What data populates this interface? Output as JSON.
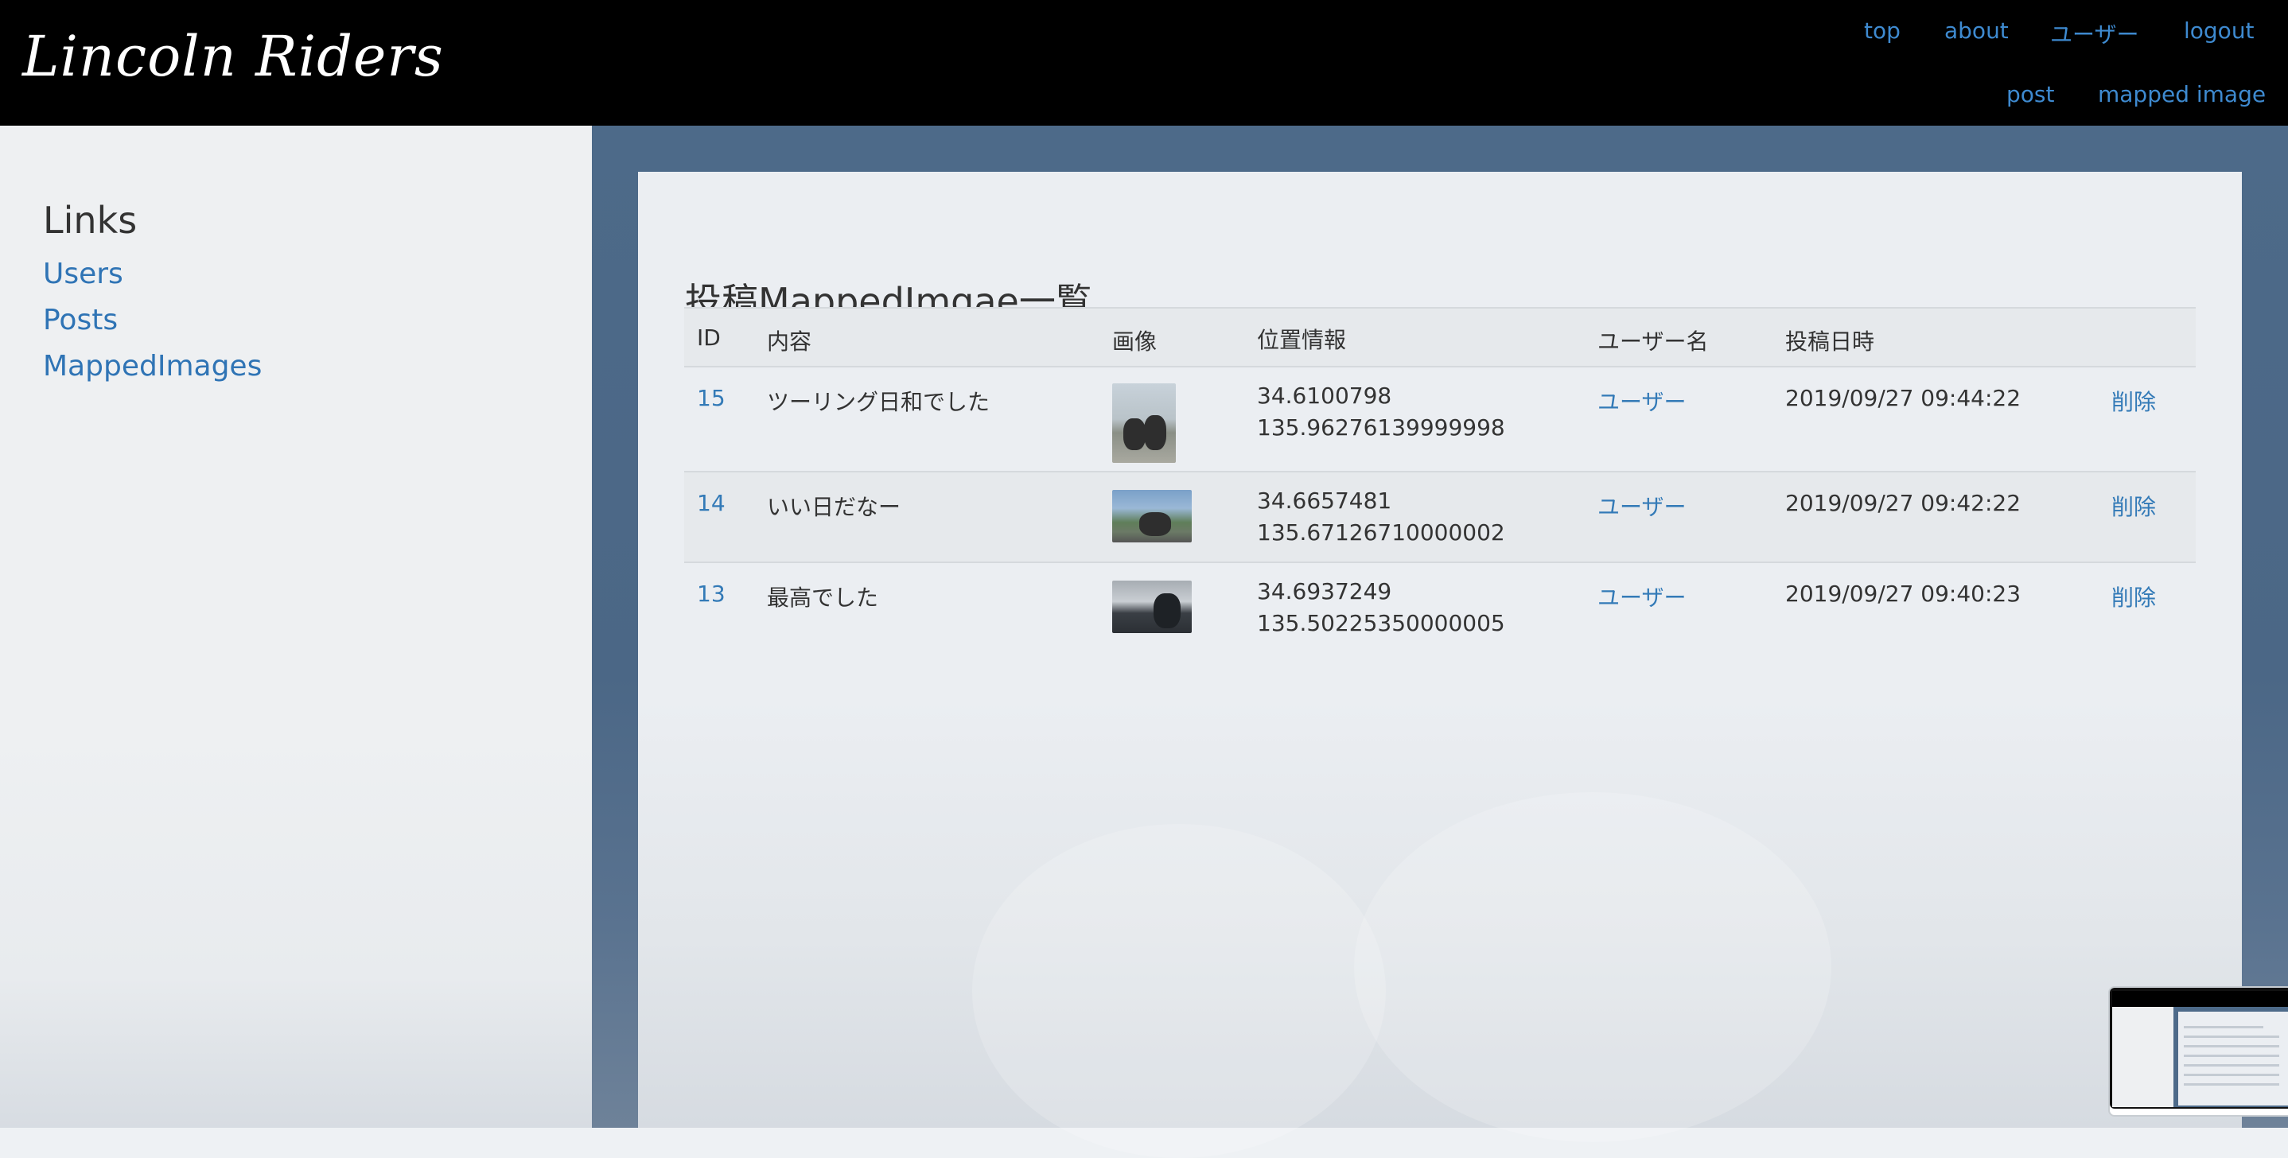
{
  "header": {
    "brand": "Lincoln Riders",
    "nav": [
      {
        "label": "top"
      },
      {
        "label": "about"
      },
      {
        "label": "ユーザー"
      },
      {
        "label": "logout"
      },
      {
        "label": "post"
      },
      {
        "label": "mapped image"
      }
    ]
  },
  "sidebar": {
    "title": "Links",
    "links": [
      {
        "label": "Users"
      },
      {
        "label": "Posts"
      },
      {
        "label": "MappedImages"
      }
    ]
  },
  "main": {
    "title": "投稿MappedImgae一覧",
    "columns": [
      "ID",
      "内容",
      "画像",
      "位置情報",
      "ユーザー名",
      "投稿日時"
    ],
    "rows": [
      {
        "id": "15",
        "content": "ツーリング日和でした",
        "lat": "34.6100798",
        "lng": "135.96276139999998",
        "user": "ユーザー",
        "date": "2019/09/27 09:44:22",
        "delete": "削除"
      },
      {
        "id": "14",
        "content": "いい日だなー",
        "lat": "34.6657481",
        "lng": "135.67126710000002",
        "user": "ユーザー",
        "date": "2019/09/27 09:42:22",
        "delete": "削除"
      },
      {
        "id": "13",
        "content": "最高でした",
        "lat": "34.6937249",
        "lng": "135.50225350000005",
        "user": "ユーザー",
        "date": "2019/09/27 09:40:23",
        "delete": "削除"
      }
    ]
  },
  "colors": {
    "header_bg": "#000000",
    "link": "#337ab7",
    "main_bg": "#4d6a89",
    "panel_bg": "#ebeef2"
  }
}
